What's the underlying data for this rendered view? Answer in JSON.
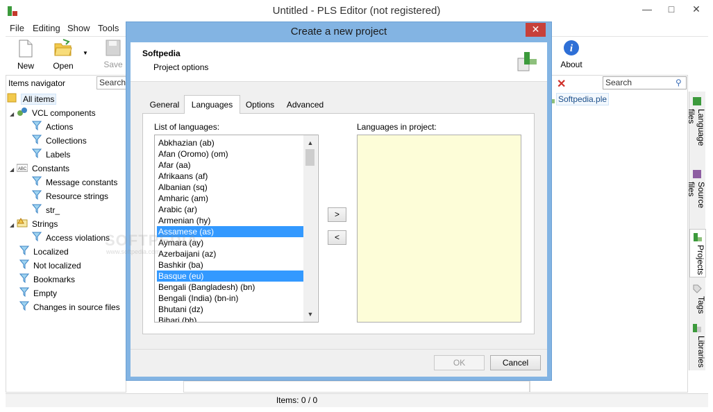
{
  "window": {
    "title": "Untitled - PLS Editor (not registered)",
    "minimize": "—",
    "maximize": "□",
    "close": "✕"
  },
  "menu": [
    "File",
    "Editing",
    "Show",
    "Tools"
  ],
  "toolbar": {
    "new_label": "New",
    "open_label": "Open",
    "save_label": "Save",
    "about_label": "About"
  },
  "navigator": {
    "title": "Items navigator",
    "search_placeholder": "Search",
    "items": [
      {
        "label": "All items"
      },
      {
        "label": "VCL components"
      },
      {
        "label": "Actions"
      },
      {
        "label": "Collections"
      },
      {
        "label": "Labels"
      },
      {
        "label": "Constants"
      },
      {
        "label": "Message constants"
      },
      {
        "label": "Resource strings"
      },
      {
        "label": "str_"
      },
      {
        "label": "Strings"
      },
      {
        "label": "Access violations"
      },
      {
        "label": "Localized"
      },
      {
        "label": "Not localized"
      },
      {
        "label": "Bookmarks"
      },
      {
        "label": "Empty"
      },
      {
        "label": "Changes in source files"
      }
    ]
  },
  "right_panel": {
    "search_placeholder": "Search",
    "file_item": "Softpedia.ple"
  },
  "side_tabs": [
    "Language files",
    "Source files",
    "Projects",
    "Tags",
    "Libraries"
  ],
  "status": {
    "items": "Items: 0 / 0"
  },
  "dialog": {
    "title": "Create a new project",
    "close": "✕",
    "heading": "Softpedia",
    "subheading": "Project options",
    "tabs": [
      "General",
      "Languages",
      "Options",
      "Advanced"
    ],
    "active_tab": "Languages",
    "list_label": "List of languages:",
    "project_label": "Languages in project:",
    "languages": [
      "Abkhazian (ab)",
      "Afan (Oromo) (om)",
      "Afar (aa)",
      "Afrikaans (af)",
      "Albanian (sq)",
      "Amharic (am)",
      "Arabic (ar)",
      "Armenian (hy)",
      "Assamese (as)",
      "Aymara (ay)",
      "Azerbaijani (az)",
      "Bashkir (ba)",
      "Basque (eu)",
      "Bengali (Bangladesh) (bn)",
      "Bengali (India) (bn-in)",
      "Bhutani (dz)",
      "Bihari (bh)"
    ],
    "selected_languages": [
      "Assamese (as)",
      "Basque (eu)"
    ],
    "add_button": ">",
    "remove_button": "<",
    "ok_button": "OK",
    "cancel_button": "Cancel"
  },
  "watermark": {
    "text": "SOFTPEDIA",
    "url": "www.softpedia.com"
  },
  "colors": {
    "dialog_frame": "#83b4e3",
    "selection": "#3399ff",
    "project_list_bg": "#fdfdd8",
    "close_red": "#c7403a"
  }
}
